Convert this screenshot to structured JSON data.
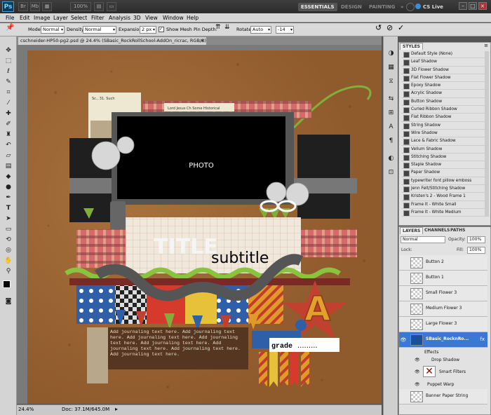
{
  "app": {
    "logo": "Ps",
    "cs_live": "CS Live"
  },
  "titlebar": {
    "zoom": "100%",
    "workspaces": [
      "ESSENTIALS",
      "DESIGN",
      "PAINTING",
      "»"
    ]
  },
  "menu": [
    "File",
    "Edit",
    "Image",
    "Layer",
    "Select",
    "Filter",
    "Analysis",
    "3D",
    "View",
    "Window",
    "Help"
  ],
  "options": {
    "mode_label": "Mode:",
    "mode_value": "Normal",
    "density_label": "Density:",
    "density_value": "Normal",
    "expansion_label": "Expansion:",
    "expansion_value": "2 px",
    "show_mesh": "Show Mesh",
    "pin_depth_label": "Pin Depth:",
    "rotate_label": "Rotate:",
    "rotate_value": "Auto",
    "angle_value": "-14"
  },
  "document": {
    "tab_title": "cschneider-HP50-pg2.psd @ 24.4% (SBasic_RockRollSchool-AddOn_ricrac, RGB/8) *",
    "zoom": "24.4%",
    "doc_size": "Doc: 37.1M/645.0M"
  },
  "canvas": {
    "photo_label": "PHOTO",
    "title_text": "TITLE",
    "subtitle_text": "subtitle",
    "journal_text": "Add journaling text here. Add journaling text here. Add journaling text here. Add journaling text here. Add journaling text here. Add journaling text here. Add journaling text here. Add journaling text here.",
    "grade_label": "grade",
    "big_letter": "A",
    "clipping_text": "Lord Jesus Ch Some Historical",
    "clipping_text2": "Sc., 31. Such"
  },
  "styles_panel": {
    "tab": "STYLES",
    "items": [
      "Default Style (None)",
      "Leaf Shadow",
      "3D Flower Shadow",
      "Flat Flower Shadow",
      "Epoxy Shadow",
      "Acrylic Shadow",
      "Button Shadow",
      "Curled Ribbon Shadow",
      "Flat Ribbon Shadow",
      "String Shadow",
      "Wire Shadow",
      "Lace & Fabric Shadow",
      "Vellum Shadow",
      "Stitching Shadow",
      "Staple Shadow",
      "Paper Shadow",
      "typewriter font pillow emboss",
      "Jenn Felt/Stitching Shadow",
      "Kristen's 2 - Wood Frame 1",
      "Frame It - White Small",
      "Frame It - White Medium"
    ]
  },
  "layers_panel": {
    "tabs": [
      "LAYERS",
      "CHANNELS",
      "PATHS"
    ],
    "blend_mode": "Normal",
    "opacity_label": "Opacity:",
    "opacity_value": "100%",
    "lock_label": "Lock:",
    "fill_label": "Fill:",
    "fill_value": "100%",
    "layers": [
      "Button 2",
      "Button 1",
      "Small Flower 3",
      "Medium Flower 3",
      "Large Flower 3",
      "SBasic_RocknRo..."
    ],
    "effects_label": "Effects",
    "drop_shadow_label": "Drop Shadow",
    "smart_filters_label": "Smart Filters",
    "puppet_warp_label": "Puppet Warp",
    "last_layer": "Banner Paper String"
  },
  "colors": {
    "accent_blue": "#3b8fd9",
    "cork": "#a06a36",
    "chalkboard": "#1a1a1a"
  }
}
